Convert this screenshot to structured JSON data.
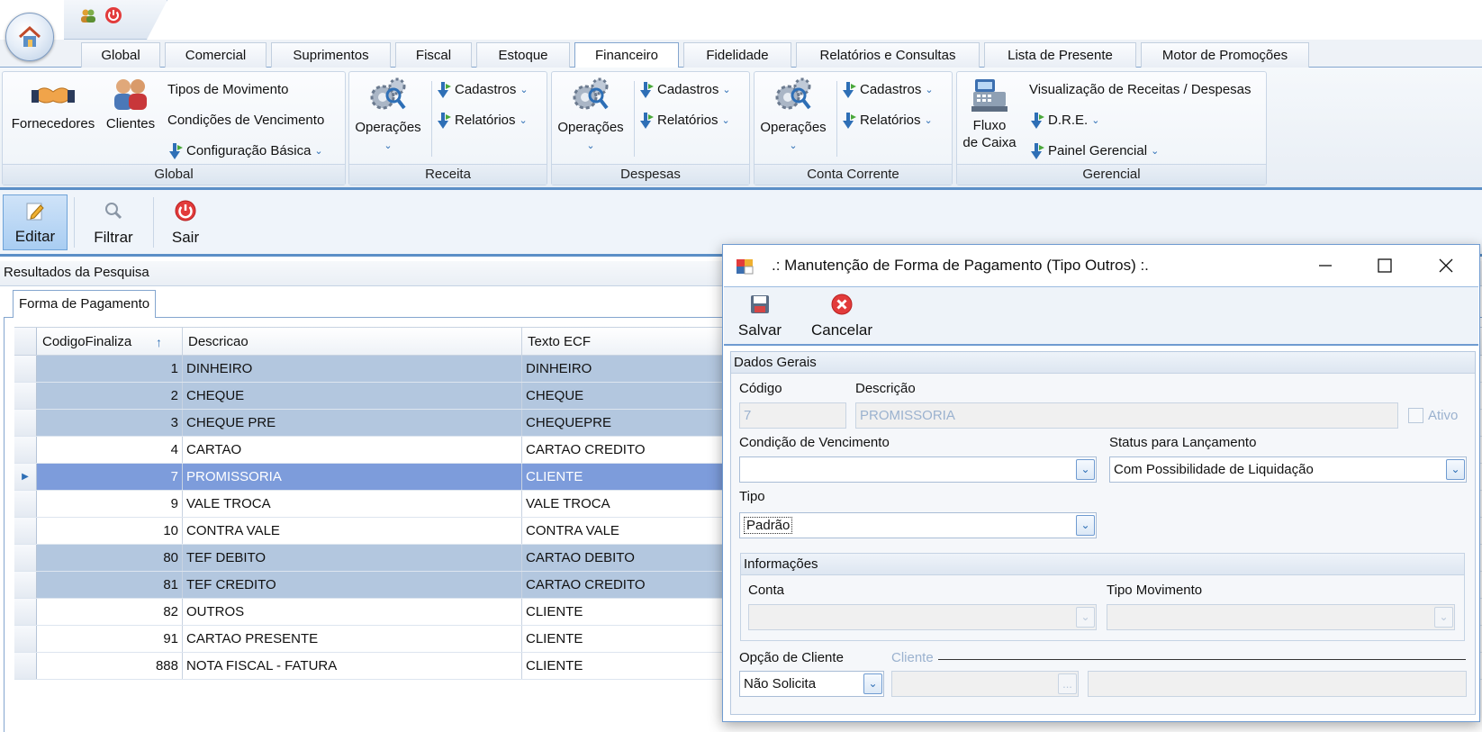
{
  "ribbon": {
    "tabs": [
      "Global",
      "Comercial",
      "Suprimentos",
      "Fiscal",
      "Estoque",
      "Financeiro",
      "Fidelidade",
      "Relatórios e Consultas",
      "Lista de Presente",
      "Motor de Promoções"
    ],
    "active_tab": "Financeiro",
    "groups": {
      "global": {
        "caption": "Global",
        "fornecedores": "Fornecedores",
        "clientes": "Clientes",
        "tipos_movimento": "Tipos de Movimento",
        "condicoes_vencimento": "Condições de Vencimento",
        "configuracao_basica": "Configuração Básica"
      },
      "receita": {
        "caption": "Receita",
        "operacoes": "Operações",
        "cadastros": "Cadastros",
        "relatorios": "Relatórios"
      },
      "despesas": {
        "caption": "Despesas",
        "operacoes": "Operações",
        "cadastros": "Cadastros",
        "relatorios": "Relatórios"
      },
      "conta_corrente": {
        "caption": "Conta Corrente",
        "operacoes": "Operações",
        "cadastros": "Cadastros",
        "relatorios": "Relatórios"
      },
      "gerencial": {
        "caption": "Gerencial",
        "fluxo_line1": "Fluxo",
        "fluxo_line2": "de Caixa",
        "visualizacao": "Visualização de Receitas / Despesas",
        "dre": "D.R.E.",
        "painel": "Painel Gerencial"
      }
    }
  },
  "toolbar": {
    "editar": "Editar",
    "filtrar": "Filtrar",
    "sair": "Sair"
  },
  "results": {
    "header": "Resultados da Pesquisa",
    "tab": "Forma de Pagamento",
    "columns": [
      "CodigoFinaliza",
      "Descricao",
      "Texto ECF"
    ],
    "rows": [
      {
        "codigo": "1",
        "descricao": "DINHEIRO",
        "ecf": "DINHEIRO",
        "state": "sel-light"
      },
      {
        "codigo": "2",
        "descricao": "CHEQUE",
        "ecf": "CHEQUE",
        "state": "sel-light"
      },
      {
        "codigo": "3",
        "descricao": "CHEQUE PRE",
        "ecf": "CHEQUEPRE",
        "state": "sel-light"
      },
      {
        "codigo": "4",
        "descricao": "CARTAO",
        "ecf": "CARTAO CREDITO",
        "state": ""
      },
      {
        "codigo": "7",
        "descricao": "PROMISSORIA",
        "ecf": "CLIENTE",
        "state": "sel-dark"
      },
      {
        "codigo": "9",
        "descricao": "VALE TROCA",
        "ecf": "VALE TROCA",
        "state": ""
      },
      {
        "codigo": "10",
        "descricao": "CONTRA VALE",
        "ecf": "CONTRA VALE",
        "state": ""
      },
      {
        "codigo": "80",
        "descricao": "TEF DEBITO",
        "ecf": "CARTAO DEBITO",
        "state": "sel-light"
      },
      {
        "codigo": "81",
        "descricao": "TEF CREDITO",
        "ecf": "CARTAO CREDITO",
        "state": "sel-light"
      },
      {
        "codigo": "82",
        "descricao": "OUTROS",
        "ecf": "CLIENTE",
        "state": ""
      },
      {
        "codigo": "91",
        "descricao": "CARTAO PRESENTE",
        "ecf": "CLIENTE",
        "state": ""
      },
      {
        "codigo": "888",
        "descricao": "NOTA FISCAL - FATURA",
        "ecf": "CLIENTE",
        "state": ""
      }
    ]
  },
  "dialog": {
    "title": ".: Manutenção de Forma de Pagamento (Tipo Outros) :.",
    "salvar": "Salvar",
    "cancelar": "Cancelar",
    "dados_gerais": "Dados Gerais",
    "codigo_label": "Código",
    "codigo_value": "7",
    "descricao_label": "Descrição",
    "descricao_value": "PROMISSORIA",
    "ativo_label": "Ativo",
    "condicao_label": "Condição de Vencimento",
    "condicao_value": "",
    "status_label": "Status para Lançamento",
    "status_value": "Com Possibilidade de Liquidação",
    "tipo_label": "Tipo",
    "tipo_value": "Padrão",
    "informacoes": "Informações",
    "conta_label": "Conta",
    "conta_value": "",
    "tipo_movimento_label": "Tipo Movimento",
    "tipo_movimento_value": "",
    "opcao_cliente_label": "Opção de Cliente",
    "opcao_cliente_value": "Não Solicita",
    "cliente_label": "Cliente",
    "cliente_browse": "..."
  },
  "colors": {
    "accent": "#5b8fc7",
    "row_selected_light": "#b3c7df",
    "row_selected_dark": "#7d9cdb"
  }
}
